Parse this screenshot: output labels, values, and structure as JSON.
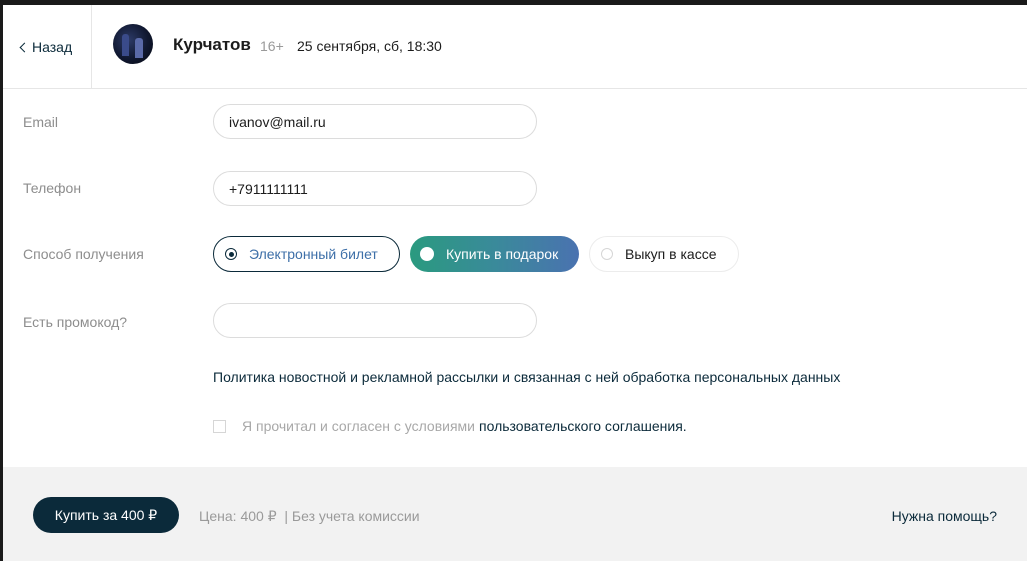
{
  "header": {
    "back_label": "Назад",
    "event_title": "Курчатов",
    "age_rating": "16+",
    "datetime": "25 сентября, сб, 18:30"
  },
  "form": {
    "email": {
      "label": "Email",
      "value": "ivanov@mail.ru"
    },
    "phone": {
      "label": "Телефон",
      "value": "+7911111111"
    },
    "delivery": {
      "label": "Способ получения",
      "options": [
        {
          "label": "Электронный билет",
          "selected": true
        },
        {
          "label": "Купить в подарок",
          "highlighted": true
        },
        {
          "label": "Выкуп в кассе",
          "selected": false
        }
      ]
    },
    "promo": {
      "label": "Есть промокод?",
      "value": ""
    },
    "policy_text": "Политика новостной и рекламной рассылки и связанная с ней обработка персональных данных",
    "agreement": {
      "text": "Я прочитал и согласен с условиями",
      "link": "пользовательского соглашения."
    }
  },
  "footer": {
    "buy_label": "Купить за 400 ₽",
    "price_text": "Цена: 400 ₽  | Без учета комиссии",
    "help_label": "Нужна помощь?"
  },
  "colors": {
    "primary": "#0b2a3a",
    "accent_gradient_start": "#2a9a7f",
    "accent_gradient_end": "#4a72b0",
    "link_blue": "#3d6fa8"
  }
}
